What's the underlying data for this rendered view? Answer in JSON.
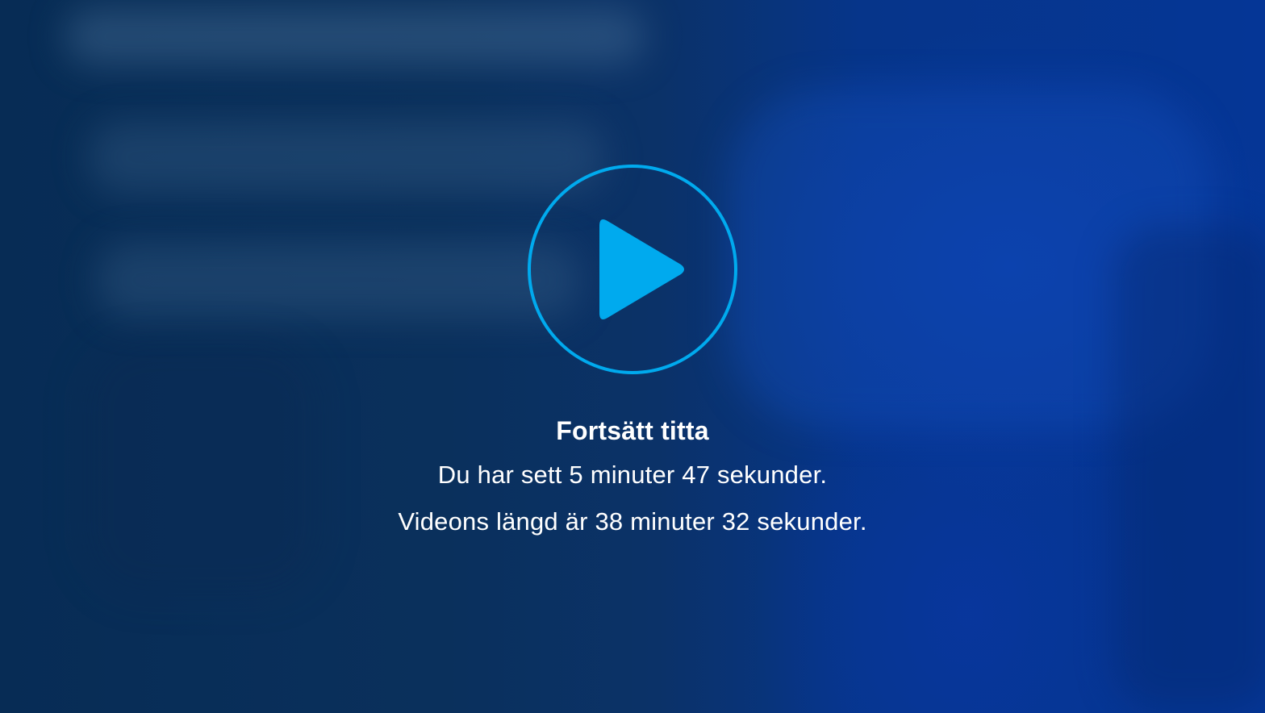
{
  "resume_prompt": {
    "title": "Fortsätt titta",
    "watched_text": "Du har sett 5 minuter 47 sekunder.",
    "duration_text": "Videons längd är 38 minuter 32 sekunder."
  },
  "play_button": {
    "icon": "play-icon",
    "accent_color": "#00aaee"
  }
}
